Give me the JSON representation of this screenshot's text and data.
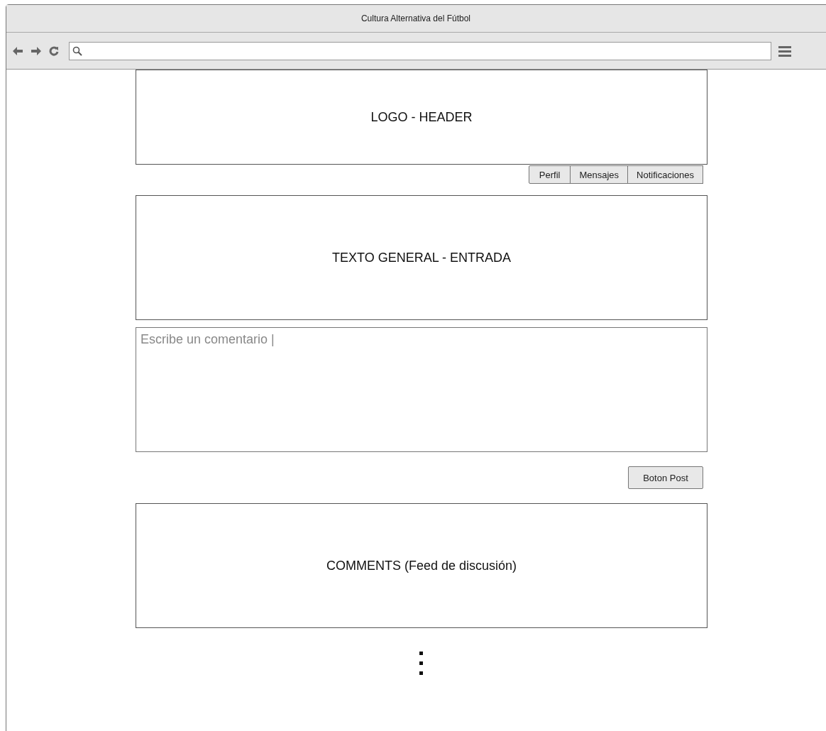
{
  "window": {
    "title": "Cultura Alternativa del Fútbol"
  },
  "header": {
    "label": "LOGO - HEADER"
  },
  "nav_tabs": [
    "Perfil",
    "Mensajes",
    "Notificaciones"
  ],
  "entry": {
    "label": "TEXTO GENERAL - ENTRADA"
  },
  "comment_field": {
    "placeholder": "Escribe un comentario |"
  },
  "post_button": {
    "label": "Boton Post"
  },
  "comments": {
    "label": "COMMENTS (Feed de discusión)"
  }
}
